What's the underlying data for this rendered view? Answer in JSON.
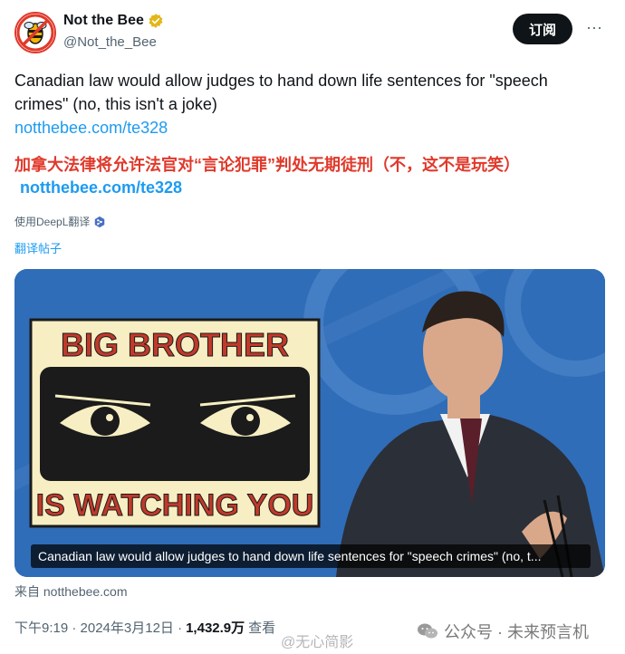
{
  "account": {
    "display_name": "Not the Bee",
    "handle": "@Not_the_Bee"
  },
  "actions": {
    "subscribe_label": "订阅",
    "more_label": "···"
  },
  "tweet": {
    "text": "Canadian law would allow judges to hand down life sentences for \"speech crimes\" (no, this isn't a joke)",
    "link": "notthebee.com/te328",
    "translated_text": "加拿大法律将允许法官对“言论犯罪”判处无期徒刑（不，这不是玩笑）",
    "translated_link": "notthebee.com/te328",
    "deepl_label": "使用DeepL翻译",
    "translate_post_label": "翻译帖子"
  },
  "media": {
    "poster_line1": "BIG BROTHER",
    "poster_line2": "IS WATCHING YOU",
    "caption": "Canadian law would allow judges to hand down life sentences for \"speech crimes\" (no, t..."
  },
  "source": "来自 notthebee.com",
  "meta": {
    "time": "下午9:19 · 2024年3月12日 ·",
    "views_count": "1,432.9万",
    "views_label": "查看"
  },
  "watermarks": {
    "weibo": "@无心简影",
    "wechat": "公众号 · 未来预言机"
  },
  "colors": {
    "accent": "#1d9bf0",
    "translation_red": "#e0392b",
    "verified_gold": "#e2b719"
  },
  "icons": [
    "bee-avatar-icon",
    "verified-badge-icon",
    "deepl-icon",
    "more-icon",
    "wechat-icon"
  ]
}
